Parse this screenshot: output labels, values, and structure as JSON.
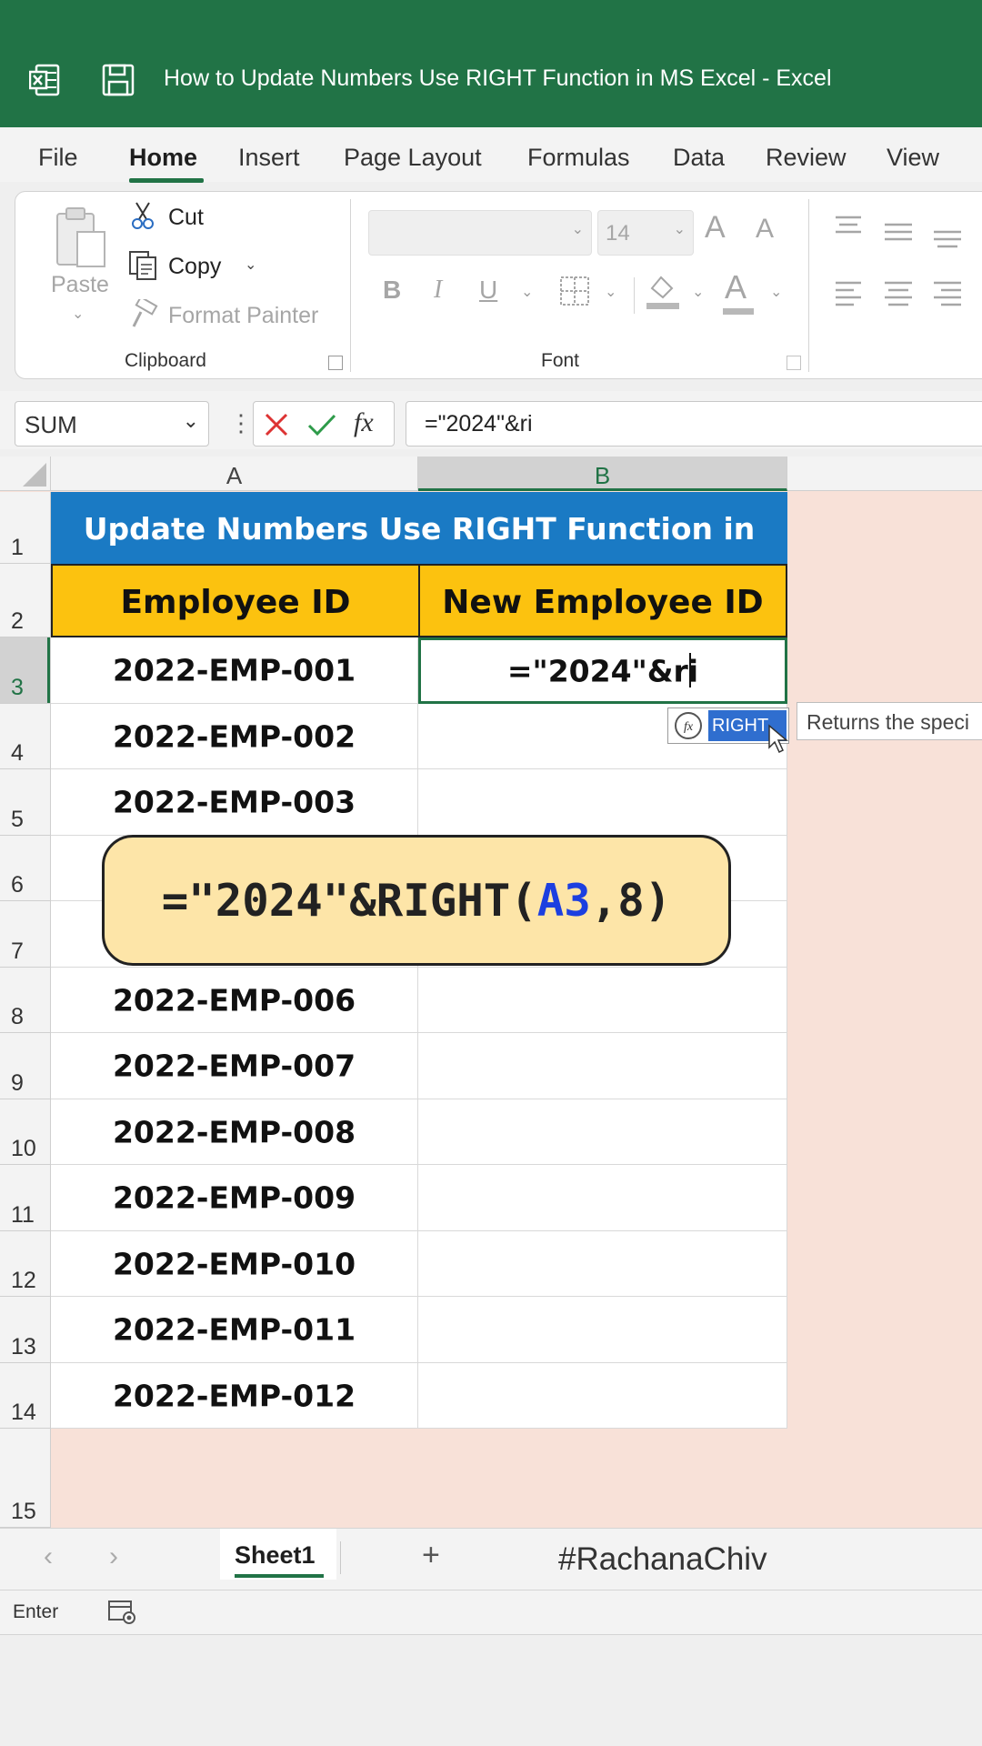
{
  "window": {
    "title": "How to Update Numbers Use RIGHT Function in MS Excel  -  Excel",
    "accent_color": "#217346",
    "icons": [
      "excel-logo-icon",
      "save-icon"
    ]
  },
  "tabs": [
    "File",
    "Home",
    "Insert",
    "Page Layout",
    "Formulas",
    "Data",
    "Review",
    "View"
  ],
  "active_tab": "Home",
  "ribbon": {
    "clipboard": {
      "paste": "Paste",
      "cut": "Cut",
      "copy": "Copy",
      "format_painter": "Format Painter",
      "group_label": "Clipboard"
    },
    "font": {
      "font_name": "",
      "font_size": "14",
      "group_label": "Font",
      "bold": "B",
      "italic": "I",
      "underline": "U",
      "grow": "A",
      "shrink": "A",
      "font_color": "A"
    }
  },
  "formula_bar": {
    "name_box": "SUM",
    "fx": "fx",
    "formula": "=\"2024\"&ri"
  },
  "columns": [
    "A",
    "B"
  ],
  "sheet": {
    "banner": "Update Numbers Use RIGHT Function in Excel",
    "header_a": "Employee ID",
    "header_b": "New Employee ID",
    "editing_cell": "=\"2024\"&ri",
    "row_numbers": [
      "1",
      "2",
      "3",
      "4",
      "5",
      "6",
      "7",
      "8",
      "9",
      "10",
      "11",
      "12",
      "13",
      "14",
      "15"
    ],
    "employee_ids": [
      "2022-EMP-001",
      "2022-EMP-002",
      "2022-EMP-003",
      "",
      "",
      "2022-EMP-006",
      "2022-EMP-007",
      "2022-EMP-008",
      "2022-EMP-009",
      "2022-EMP-010",
      "2022-EMP-011",
      "2022-EMP-012"
    ]
  },
  "autocomplete": {
    "item": "RIGHT",
    "tooltip": "Returns the speci"
  },
  "callout": {
    "prefix": "=\"2024\"&RIGHT(",
    "ref": "A3",
    "suffix": ",8)"
  },
  "sheet_tabs": {
    "active": "Sheet1",
    "add": "+",
    "watermark": "#RachanaChiv"
  },
  "status_bar": {
    "mode": "Enter"
  }
}
